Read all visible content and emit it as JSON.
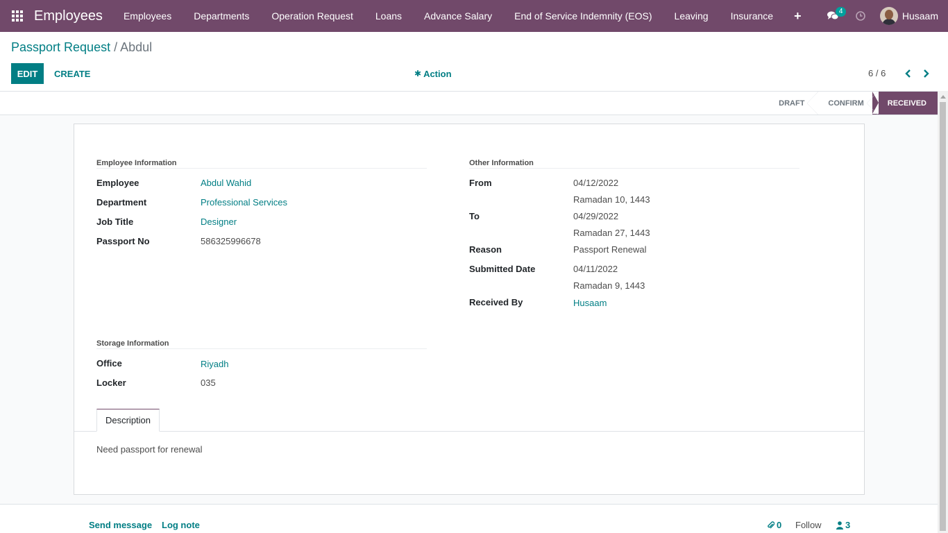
{
  "navbar": {
    "app_name": "Employees",
    "menu": [
      "Employees",
      "Departments",
      "Operation Request",
      "Loans",
      "Advance Salary",
      "End of Service Indemnity (EOS)",
      "Leaving",
      "Insurance"
    ],
    "plus": "+",
    "chat_count": "4",
    "user_name": "Husaam",
    "color": "#71496a"
  },
  "control": {
    "breadcrumb_parent": "Passport Request",
    "breadcrumb_sep": " / ",
    "breadcrumb_current": "Abdul",
    "edit_label": "EDIT",
    "create_label": "CREATE",
    "action_label": "Action",
    "pager": "6 / 6"
  },
  "status": {
    "stages": [
      "DRAFT",
      "CONFIRM",
      "RECEIVED"
    ],
    "active": "RECEIVED"
  },
  "form": {
    "employee_info": {
      "title": "Employee Information",
      "employee_label": "Employee",
      "employee": "Abdul Wahid",
      "department_label": "Department",
      "department": "Professional Services",
      "job_label": "Job Title",
      "job": "Designer",
      "passport_label": "Passport No",
      "passport": "586325996678"
    },
    "other_info": {
      "title": "Other Information",
      "from_label": "From",
      "from": "04/12/2022",
      "from_hijri": "Ramadan 10, 1443",
      "to_label": "To",
      "to": "04/29/2022",
      "to_hijri": "Ramadan 27, 1443",
      "reason_label": "Reason",
      "reason": "Passport Renewal",
      "submitted_label": "Submitted Date",
      "submitted": "04/11/2022",
      "submitted_hijri": "Ramadan 9, 1443",
      "received_label": "Received By",
      "received": "Husaam"
    },
    "storage_info": {
      "title": "Storage Information",
      "office_label": "Office",
      "office": "Riyadh",
      "locker_label": "Locker",
      "locker": "035"
    },
    "tab_label": "Description",
    "description": "Need passport for renewal"
  },
  "chatter": {
    "send_message": "Send message",
    "log_note": "Log note",
    "attachments": "0",
    "follow": "Follow",
    "followers": "3"
  },
  "colors": {
    "accent": "#017e84",
    "primary": "#71496a"
  }
}
